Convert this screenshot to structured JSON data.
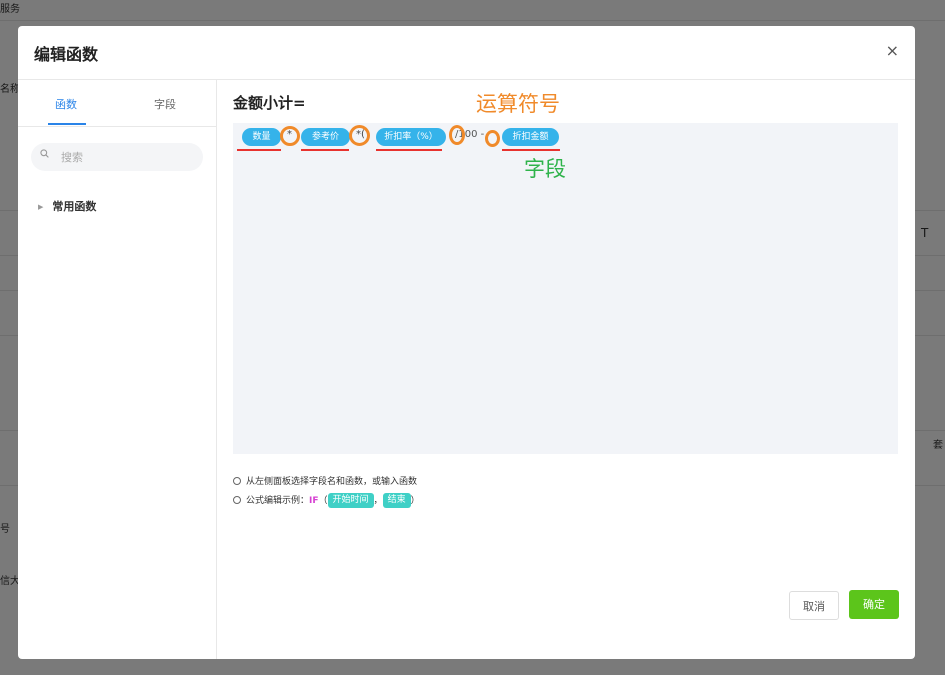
{
  "background": {
    "labels": [
      "服务",
      "名称",
      "T",
      "套",
      "号",
      "信大"
    ]
  },
  "modal": {
    "title": "编辑函数",
    "close_glyph": "×"
  },
  "left": {
    "tabs": [
      {
        "label": "函数",
        "active": true
      },
      {
        "label": "字段",
        "active": false
      }
    ],
    "search_placeholder": "搜索",
    "tree": [
      {
        "label": "常用函数"
      }
    ]
  },
  "formula": {
    "title": "金额小计=",
    "tokens": [
      {
        "type": "field",
        "label": "数量"
      },
      {
        "type": "op",
        "label": "*"
      },
      {
        "type": "field",
        "label": "参考价"
      },
      {
        "type": "op",
        "label": "*("
      },
      {
        "type": "field",
        "label": "折扣率（%）"
      },
      {
        "type": "op",
        "label": "/100 -"
      },
      {
        "type": "field",
        "label": "折扣金额"
      }
    ]
  },
  "annotations": {
    "operator_label": "运算符号",
    "field_label": "字段"
  },
  "hints": {
    "line1": "从左侧面板选择字段名和函数，或输入函数",
    "line2_prefix": "公式编辑示例：",
    "line2_keyword": "IF",
    "line2_open": "（",
    "line2_chip1": "开始时间",
    "line2_sep": "，",
    "line2_chip2": "结束",
    "line2_close": "）"
  },
  "buttons": {
    "cancel": "取消",
    "ok": "确定"
  },
  "colors": {
    "accent": "#2a84e8",
    "field_pill": "#35b3ea",
    "operator_highlight": "#f08a2a",
    "field_annotation": "#2eb34a",
    "underline": "#e8322e",
    "confirm_button": "#5cc51b",
    "example_chip": "#3fd0c6",
    "keyword": "#d63fd2"
  }
}
